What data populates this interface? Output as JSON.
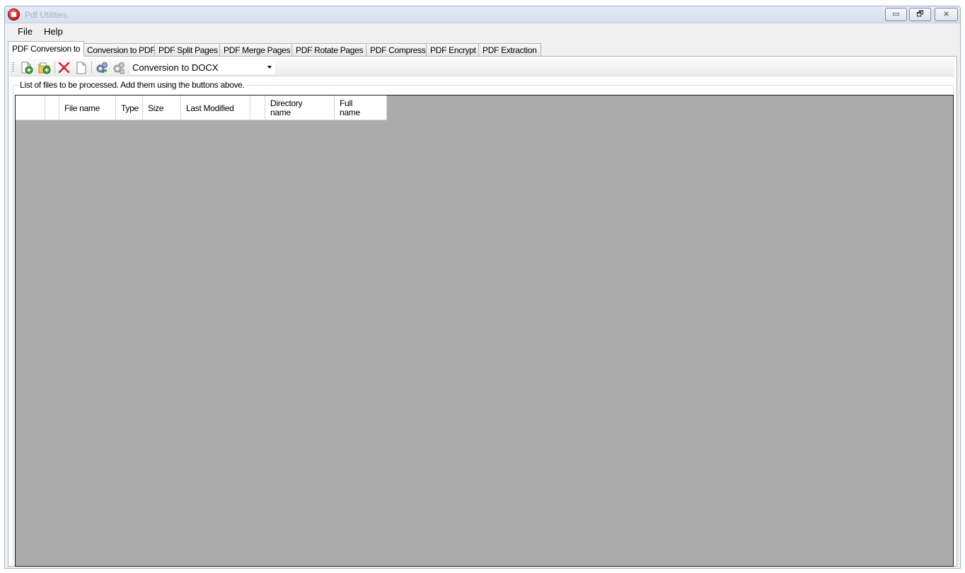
{
  "window": {
    "title": "Pdf Utilities",
    "controls": {
      "minimize": "▭",
      "restore": "🗗",
      "close": "⨯"
    }
  },
  "menu": {
    "items": [
      "File",
      "Help"
    ]
  },
  "tabs": [
    {
      "label": "PDF Conversion to",
      "active": true
    },
    {
      "label": "Conversion to PDF",
      "active": false
    },
    {
      "label": "PDF Split Pages",
      "active": false
    },
    {
      "label": "PDF Merge Pages",
      "active": false
    },
    {
      "label": "PDF Rotate Pages",
      "active": false
    },
    {
      "label": "PDF Compress",
      "active": false
    },
    {
      "label": "PDF Encrypt",
      "active": false
    },
    {
      "label": "PDF Extraction",
      "active": false
    }
  ],
  "toolbar": {
    "icons": [
      "add-file-icon",
      "add-folder-icon",
      "delete-icon",
      "clear-list-icon",
      "process-icon",
      "process-all-icon"
    ],
    "conversion_select_value": "Conversion to DOCX"
  },
  "file_list": {
    "caption": "List of files to be processed. Add  them using the buttons above.",
    "columns": [
      {
        "line1": "",
        "line2": ""
      },
      {
        "line1": "",
        "line2": ""
      },
      {
        "line1": "File name",
        "line2": ""
      },
      {
        "line1": "Type",
        "line2": ""
      },
      {
        "line1": "Size",
        "line2": ""
      },
      {
        "line1": "Last Modified",
        "line2": ""
      },
      {
        "line1": "",
        "line2": ""
      },
      {
        "line1": "Directory",
        "line2": "name"
      },
      {
        "line1": "Full",
        "line2": "name"
      }
    ],
    "rows": []
  },
  "colors": {
    "list_background": "#ababab",
    "titlebar": "#d6e1ee",
    "accent_red": "#d21a1a"
  }
}
